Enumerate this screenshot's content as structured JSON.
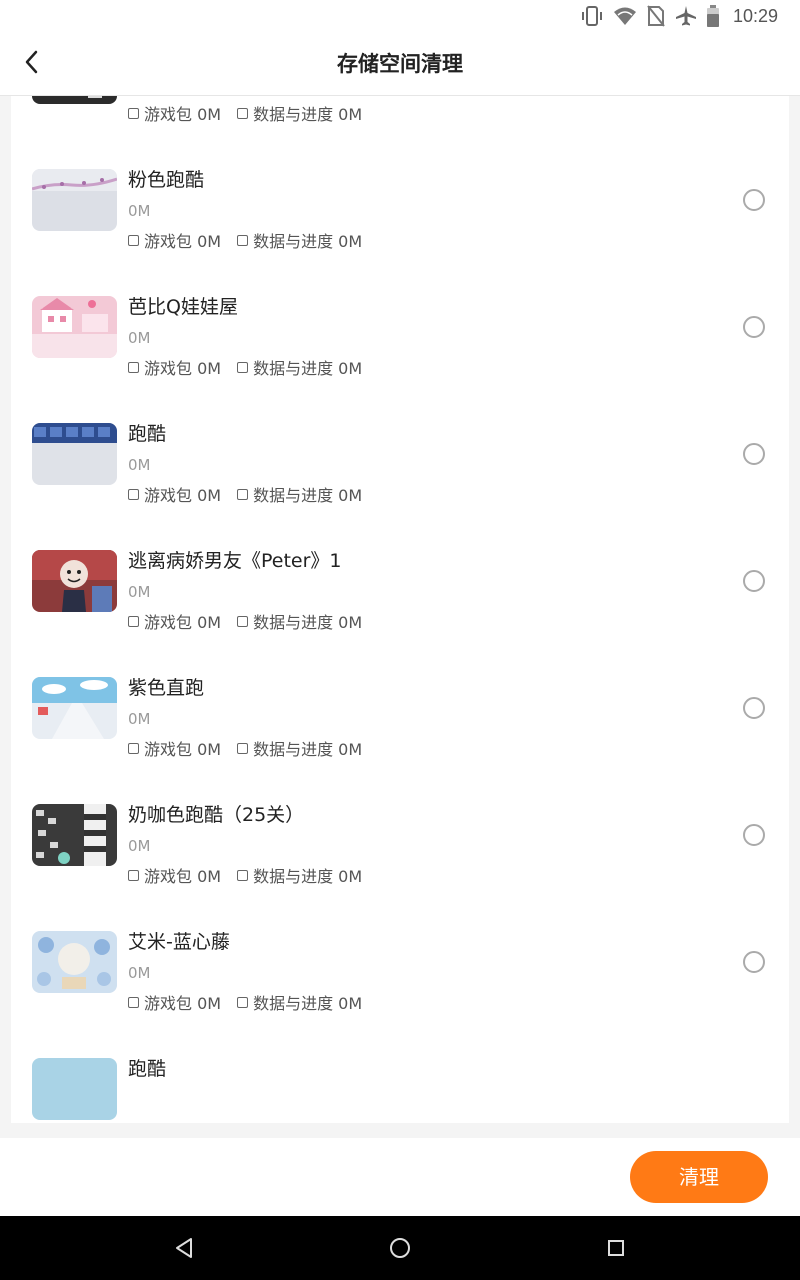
{
  "status_bar": {
    "time": "10:29",
    "icons": [
      "vibrate-icon",
      "wifi-icon",
      "no-sim-icon",
      "airplane-icon",
      "battery-icon"
    ]
  },
  "header": {
    "title": "存储空间清理",
    "back_icon": "chevron-left-icon"
  },
  "list": {
    "items": [
      {
        "name": "",
        "size": "0M",
        "pkg_label": "游戏包 0M",
        "data_label": "数据与进度 0M",
        "thumb": "dark-grid"
      },
      {
        "name": "粉色跑酷",
        "size": "0M",
        "pkg_label": "游戏包 0M",
        "data_label": "数据与进度 0M",
        "thumb": "pink-track"
      },
      {
        "name": "芭比Q娃娃屋",
        "size": "0M",
        "pkg_label": "游戏包 0M",
        "data_label": "数据与进度 0M",
        "thumb": "pink-house"
      },
      {
        "name": "跑酷",
        "size": "0M",
        "pkg_label": "游戏包 0M",
        "data_label": "数据与进度 0M",
        "thumb": "blue-tiles"
      },
      {
        "name": "逃离病娇男友《Peter》1",
        "size": "0M",
        "pkg_label": "游戏包 0M",
        "data_label": "数据与进度 0M",
        "thumb": "character"
      },
      {
        "name": "紫色直跑",
        "size": "0M",
        "pkg_label": "游戏包 0M",
        "data_label": "数据与进度 0M",
        "thumb": "sky-run"
      },
      {
        "name": "奶咖色跑酷（25关）",
        "size": "0M",
        "pkg_label": "游戏包 0M",
        "data_label": "数据与进度 0M",
        "thumb": "tower"
      },
      {
        "name": "艾米-蓝心藤",
        "size": "0M",
        "pkg_label": "游戏包 0M",
        "data_label": "数据与进度 0M",
        "thumb": "blue-floral"
      },
      {
        "name": "跑酷",
        "size": "",
        "pkg_label": "",
        "data_label": "",
        "thumb": "light-blue"
      }
    ]
  },
  "footer": {
    "clean_label": "清理",
    "accent_color": "#ff7a15"
  },
  "system_nav": {
    "icons": [
      "back-triangle-icon",
      "home-circle-icon",
      "recents-square-icon"
    ]
  }
}
